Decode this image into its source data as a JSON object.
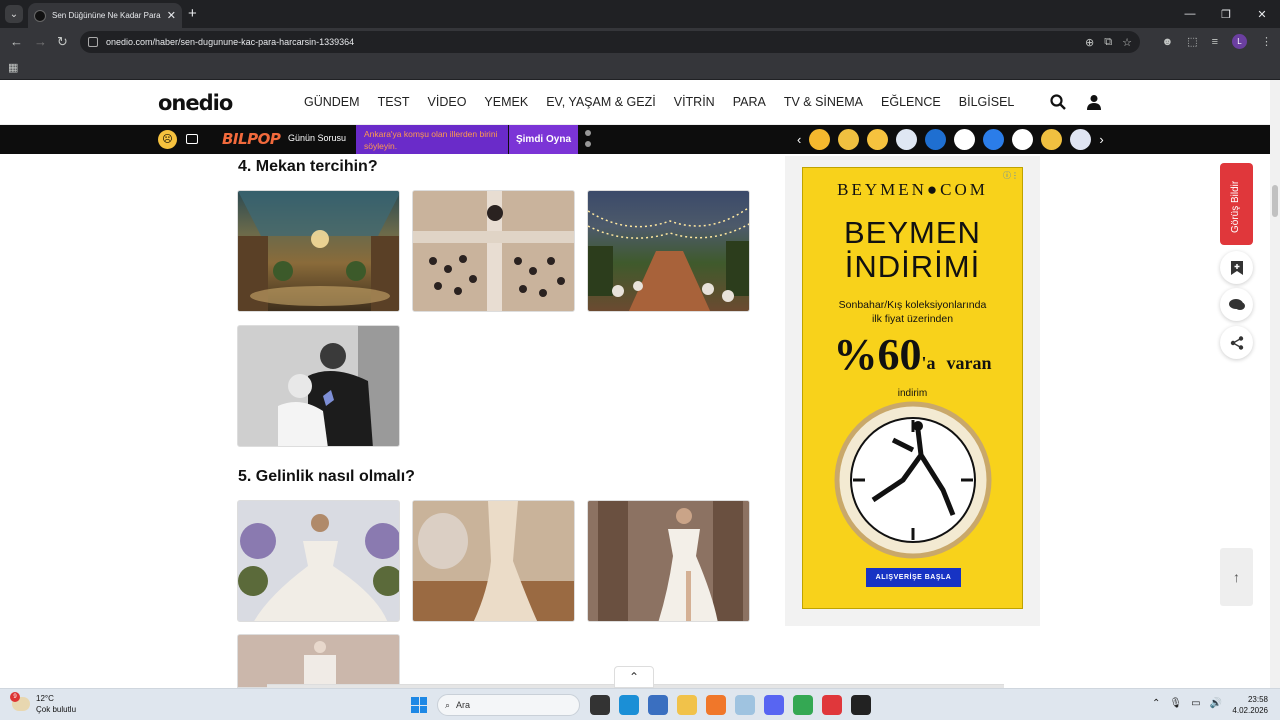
{
  "browser": {
    "tab_title": "Sen Düğününe Ne Kadar Para Harcarsın?",
    "url": "onedio.com/haber/sen-dugunune-kac-para-harcarsin-1339364",
    "profile_initial": "L"
  },
  "site": {
    "logo": "onedio",
    "nav": [
      "GÜNDEM",
      "TEST",
      "VİDEO",
      "YEMEK",
      "EV, YAŞAM & GEZİ",
      "VİTRİN",
      "PARA",
      "TV & SİNEMA",
      "EĞLENCE",
      "BİLGİSEL"
    ]
  },
  "strip": {
    "brand": "BILPOP",
    "daily_question_label": "Günün Sorusu",
    "question": "Ankara'ya komşu olan illerden birini söyleyin.",
    "play_label": "Şimdi Oyna"
  },
  "content": {
    "section4_title": "4. Mekan tercihin?",
    "section5_title": "5. Gelinlik nasıl olmalı?"
  },
  "ad": {
    "brand": "BEYMEN●COM",
    "headline_line1": "BEYMEN",
    "headline_line2": "İNDİRİMİ",
    "sub_line1": "Sonbahar/Kış koleksiyonlarında",
    "sub_line2": "ilk fiyat üzerinden",
    "discount": "%60",
    "discount_suffix_1": "'a",
    "discount_suffix_2": "varan",
    "discount_word": "indirim",
    "cta": "ALIŞVERİŞE BAŞLA"
  },
  "sidebar": {
    "feedback_label": "Görüş Bildir"
  },
  "taskbar": {
    "temp": "12°C",
    "weather": "Çok bulutlu",
    "weather_badge": "9",
    "search_placeholder": "Ara",
    "time": "23:58",
    "date": "4.02.2026"
  },
  "colors": {
    "accent_red": "#e0373b",
    "ad_yellow": "#f8d21b",
    "strip_purple": "#6a2bc9",
    "cta_blue": "#1733c4"
  }
}
